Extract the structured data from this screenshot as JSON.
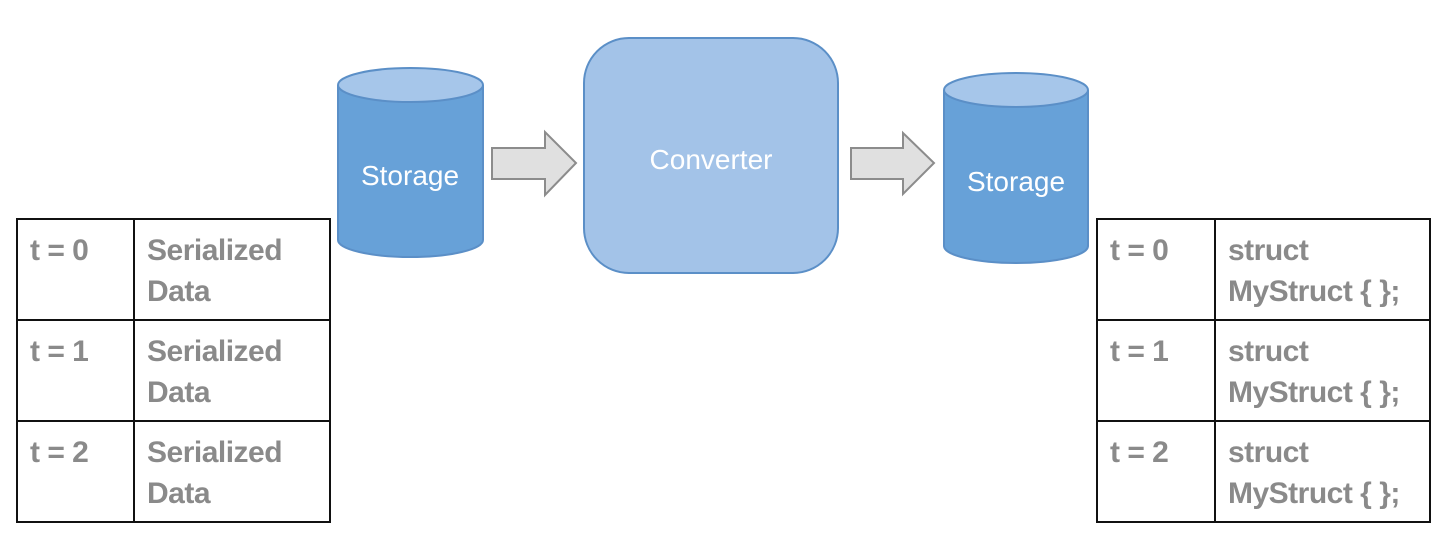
{
  "colors": {
    "storage_fill": "#67a1d8",
    "storage_top": "#a6c6ea",
    "converter_fill": "#a3c3e8",
    "outline": "#5b8fc7",
    "arrow_fill": "#e0e0e0",
    "arrow_stroke": "#8c8c8c",
    "table_text": "#8a8a8a"
  },
  "source_table": {
    "rows": [
      {
        "time": "t = 0",
        "value": "Serialized Data"
      },
      {
        "time": "t = 1",
        "value": "Serialized Data"
      },
      {
        "time": "t = 2",
        "value": "Serialized Data"
      }
    ]
  },
  "source_storage": {
    "label": "Storage"
  },
  "converter": {
    "label": "Converter"
  },
  "target_storage": {
    "label": "Storage"
  },
  "target_table": {
    "rows": [
      {
        "time": "t = 0",
        "value": "struct MyStruct { };"
      },
      {
        "time": "t = 1",
        "value": "struct MyStruct { };"
      },
      {
        "time": "t = 2",
        "value": "struct MyStruct { };"
      }
    ]
  }
}
